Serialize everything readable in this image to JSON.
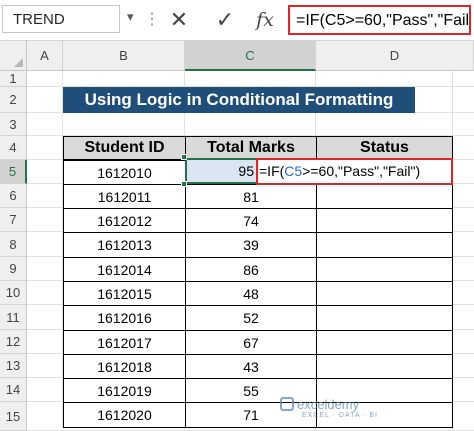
{
  "formula_bar": {
    "name_box": "TREND",
    "cancel_glyph": "✕",
    "enter_glyph": "✓",
    "fx_label": "fx",
    "formula": "=IF(C5>=60,\"Pass\",\"Fail\")"
  },
  "columns": [
    "A",
    "B",
    "C",
    "D"
  ],
  "selected_column": "C",
  "rows": [
    "1",
    "2",
    "3",
    "4",
    "5",
    "6",
    "7",
    "8",
    "9",
    "10",
    "11",
    "12",
    "13",
    "14",
    "15"
  ],
  "selected_row": "5",
  "title": "Using Logic in Conditional Formatting",
  "table": {
    "headers": [
      "Student ID",
      "Total Marks",
      "Status"
    ],
    "ids": [
      "1612010",
      "1612011",
      "1612012",
      "1612013",
      "1612014",
      "1612015",
      "1612016",
      "1612017",
      "1612018",
      "1612019",
      "1612020"
    ],
    "marks": [
      "95",
      "81",
      "74",
      "39",
      "86",
      "48",
      "52",
      "67",
      "43",
      "55",
      "71"
    ]
  },
  "edit": {
    "active_value": "95",
    "prefix": "=IF(",
    "ref": "C5",
    "suffix": ">=60,\"Pass\",\"Fail\")"
  },
  "watermark": {
    "text": "exceldemy",
    "sub": "EXCEL · DATA · BI"
  },
  "colors": {
    "banner": "#1f4e79",
    "highlight_border": "#d9262a",
    "selection": "#217346",
    "cell_ref": "#2b6cc4"
  }
}
